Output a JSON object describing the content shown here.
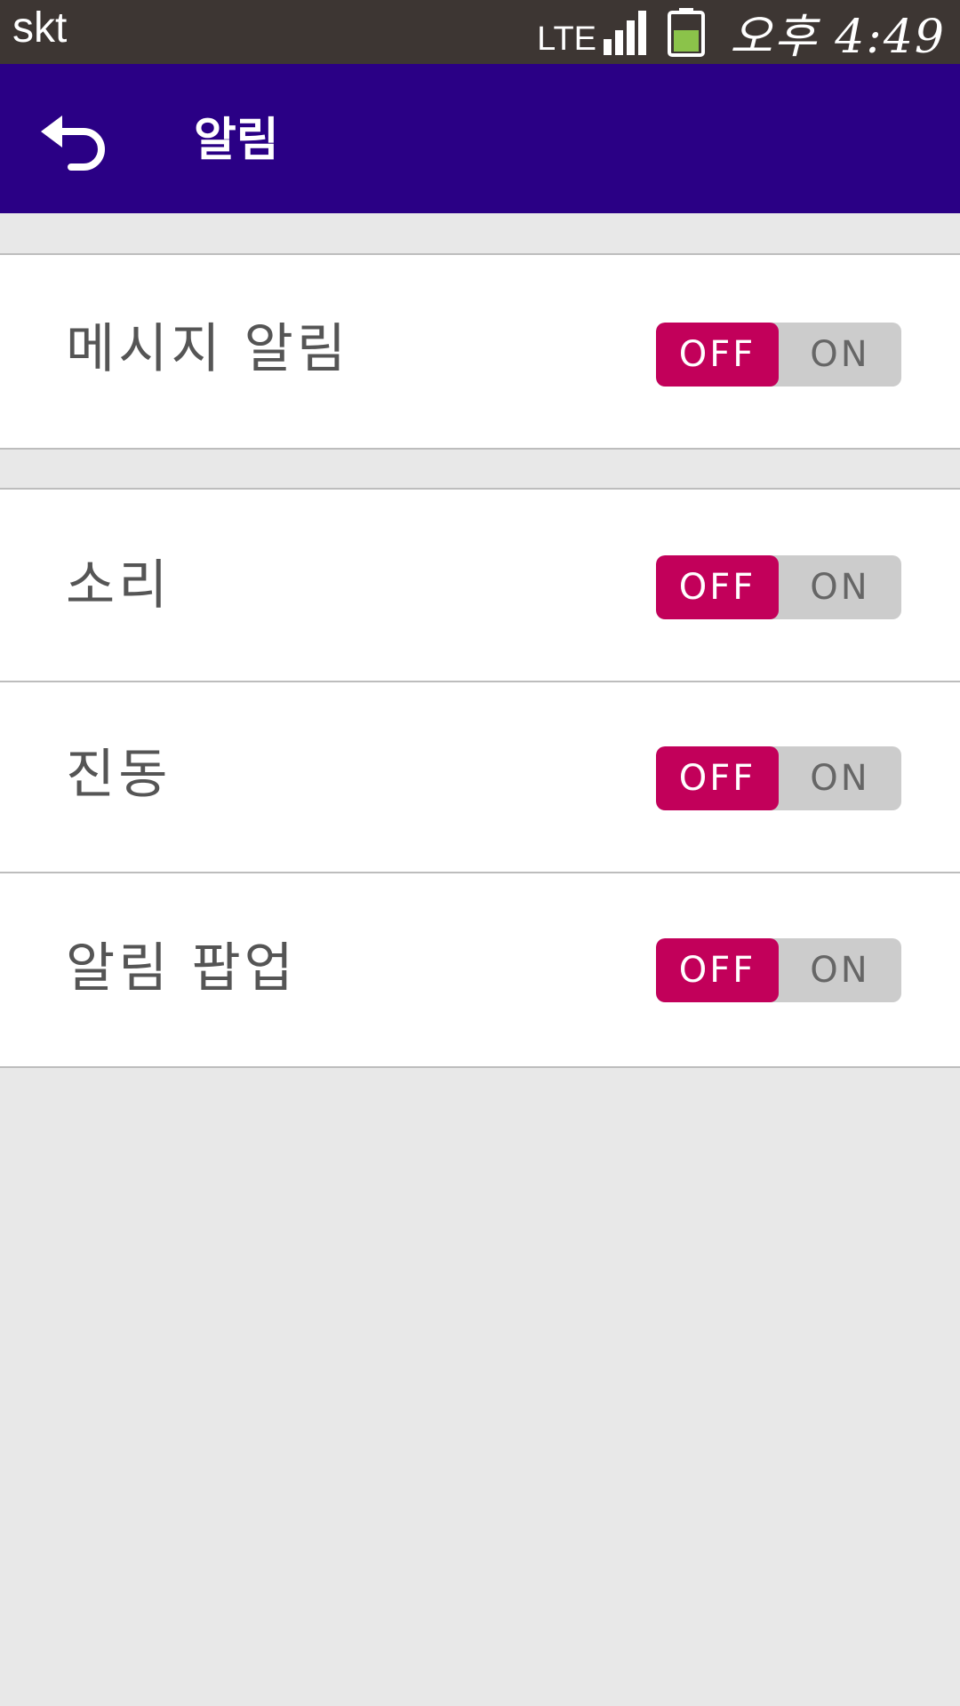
{
  "status_bar": {
    "carrier": "skt",
    "network": "LTE",
    "signal_icon": "signal-bars-icon",
    "battery_icon": "battery-icon",
    "battery_color": "#8bc34a",
    "time": "오후 4:49"
  },
  "app_bar": {
    "back_icon": "back-arrow-icon",
    "title": "알림",
    "background": "#2a0085"
  },
  "settings": [
    {
      "label": "메시지 알림",
      "off_label": "OFF",
      "on_label": "ON",
      "state": "OFF"
    },
    {
      "label": "소리",
      "off_label": "OFF",
      "on_label": "ON",
      "state": "OFF"
    },
    {
      "label": "진동",
      "off_label": "OFF",
      "on_label": "ON",
      "state": "OFF"
    },
    {
      "label": "알림 팝업",
      "off_label": "OFF",
      "on_label": "ON",
      "state": "OFF"
    }
  ],
  "colors": {
    "toggle_active": "#c2005a",
    "toggle_track": "#cccccc",
    "background": "#e8e8e8"
  }
}
